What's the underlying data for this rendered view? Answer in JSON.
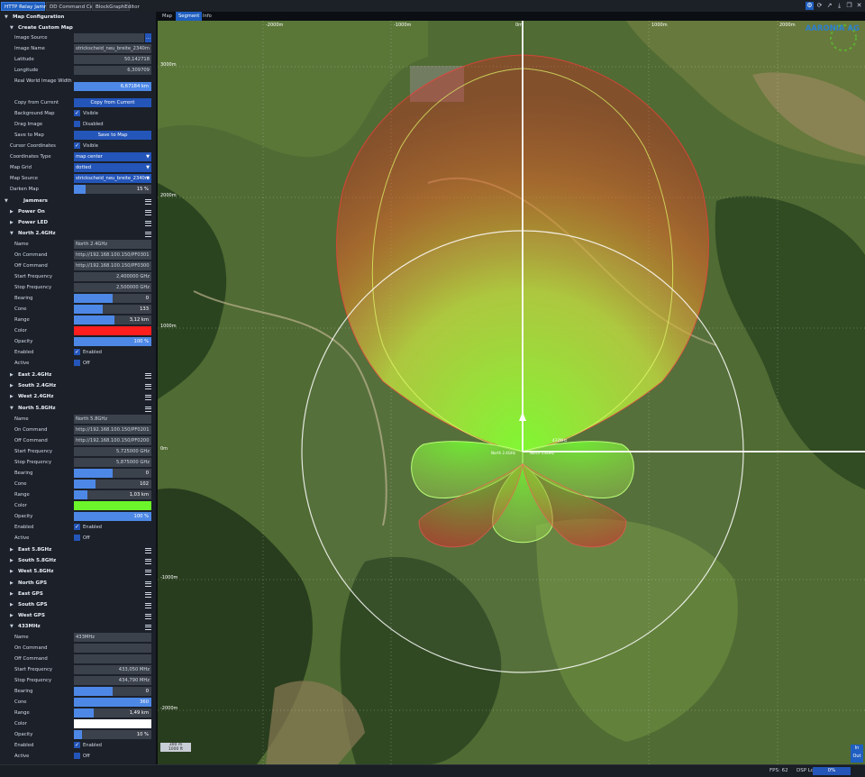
{
  "tabs": [
    "HTTP Relay Jammer",
    "DD Command Center",
    "BlockGraphEditor"
  ],
  "toolbar_icons": [
    "settings-icon",
    "refresh-icon",
    "share-icon",
    "download-icon",
    "restore-icon",
    "close-icon"
  ],
  "sidebar": {
    "map_config": "Map Configuration",
    "create_custom_map": "Create Custom Map",
    "image_source": {
      "label": "Image Source",
      "value": "",
      "button": "..."
    },
    "image_name": {
      "label": "Image Name",
      "value": "strickscheid_neu_breite_2340m"
    },
    "latitude": {
      "label": "Latitude",
      "value": "50,142718"
    },
    "longitude": {
      "label": "Longitude",
      "value": "6,309709"
    },
    "real_world_width": {
      "label": "Real World Image Width",
      "value": "6,67184 km"
    },
    "copy_from_current": {
      "label": "Copy from Current",
      "button": "Copy from Current"
    },
    "background_map": {
      "label": "Background Map",
      "value": "Visible"
    },
    "drag_image": {
      "label": "Drag Image",
      "value": "Disabled"
    },
    "save_to_map": {
      "label": "Save to Map",
      "button": "Save to Map"
    },
    "cursor_coordinates": {
      "label": "Cursor Coordinates",
      "value": "Visible"
    },
    "coordinates_type": {
      "label": "Coordinates Type",
      "value": "map center"
    },
    "map_grid": {
      "label": "Map Grid",
      "value": "dotted"
    },
    "map_source": {
      "label": "Map Source",
      "value": "strickscheid_neu_breite_2340m"
    },
    "darken_map": {
      "label": "Darken Map",
      "value": "15 %",
      "level": 0.15
    },
    "jammers": "Jammers",
    "power_on": "Power On",
    "power_led": "Power LED",
    "north24": {
      "title": "North 2.4GHz",
      "name": {
        "label": "Name",
        "value": "North 2.4GHz"
      },
      "on": {
        "label": "On Command",
        "value": "http://192.168.100.150/PF0301"
      },
      "off": {
        "label": "Off Command",
        "value": "http://192.168.100.150/PF0300"
      },
      "start": {
        "label": "Start Frequency",
        "value": "2,400000 GHz"
      },
      "stop": {
        "label": "Stop Frequency",
        "value": "2,500000 GHz"
      },
      "bearing": {
        "label": "Bearing",
        "value": "0",
        "level": 0.5
      },
      "cone": {
        "label": "Cone",
        "value": "133",
        "level": 0.37
      },
      "range": {
        "label": "Range",
        "value": "3,12 km",
        "level": 0.52
      },
      "color": {
        "label": "Color",
        "value": "#ff1e1e"
      },
      "opacity": {
        "label": "Opacity",
        "value": "100 %",
        "level": 1.0
      },
      "enabled": {
        "label": "Enabled",
        "value": "Enabled"
      },
      "active": {
        "label": "Active",
        "value": "Off"
      }
    },
    "east24": "East 2.4GHz",
    "south24": "South 2.4GHz",
    "west24": "West 2.4GHz",
    "north58": {
      "title": "North 5.8GHz",
      "name": {
        "label": "Name",
        "value": "North 5.8GHz"
      },
      "on": {
        "label": "On Command",
        "value": "http://192.168.100.150/PF0201"
      },
      "off": {
        "label": "Off Command",
        "value": "http://192.168.100.150/PF0200"
      },
      "start": {
        "label": "Start Frequency",
        "value": "5,725000 GHz"
      },
      "stop": {
        "label": "Stop Frequency",
        "value": "5,875000 GHz"
      },
      "bearing": {
        "label": "Bearing",
        "value": "0",
        "level": 0.5
      },
      "cone": {
        "label": "Cone",
        "value": "102",
        "level": 0.28
      },
      "range": {
        "label": "Range",
        "value": "1,03 km",
        "level": 0.17
      },
      "color": {
        "label": "Color",
        "value": "#6cf52a"
      },
      "opacity": {
        "label": "Opacity",
        "value": "100 %",
        "level": 1.0
      },
      "enabled": {
        "label": "Enabled",
        "value": "Enabled"
      },
      "active": {
        "label": "Active",
        "value": "Off"
      }
    },
    "east58": "East 5.8GHz",
    "south58": "South 5.8GHz",
    "west58": "West 5.8GHz",
    "northgps": "North GPS",
    "eastgps": "East GPS",
    "southgps": "South GPS",
    "westgps": "West GPS",
    "m433": {
      "title": "433MHz",
      "name": {
        "label": "Name",
        "value": "433MHz"
      },
      "on": {
        "label": "On Command",
        "value": ""
      },
      "off": {
        "label": "Off Command",
        "value": ""
      },
      "start": {
        "label": "Start Frequency",
        "value": "433,050 MHz"
      },
      "stop": {
        "label": "Stop Frequency",
        "value": "434,790 MHz"
      },
      "bearing": {
        "label": "Bearing",
        "value": "0",
        "level": 0.5
      },
      "cone": {
        "label": "Cone",
        "value": "360",
        "level": 1.0
      },
      "range": {
        "label": "Range",
        "value": "1,49 km",
        "level": 0.25
      },
      "color": {
        "label": "Color",
        "value": "#ffffff"
      },
      "opacity": {
        "label": "Opacity",
        "value": "10 %",
        "level": 0.1
      },
      "enabled": {
        "label": "Enabled",
        "value": "Enabled"
      },
      "active": {
        "label": "Active",
        "value": "Off"
      }
    }
  },
  "map": {
    "tabs": [
      "Map",
      "Segment",
      "Info"
    ],
    "x_ticks": [
      "-2000m",
      "-1000m",
      "0m",
      "1000m",
      "2000m"
    ],
    "y_ticks": [
      "3000m",
      "2000m",
      "1000m",
      "0m",
      "-1000m",
      "-2000m"
    ],
    "marker_labels": [
      "North 2.4GHz",
      "North 5.8GHz",
      "433MHz"
    ],
    "logo": "AARONIA AG",
    "scale": [
      "300 m",
      "1000 ft"
    ],
    "zoom": [
      "In",
      "Out"
    ]
  },
  "status": {
    "fps": "FPS: 62",
    "dsp_label": "DSP Load:",
    "dsp_value": "0%"
  }
}
